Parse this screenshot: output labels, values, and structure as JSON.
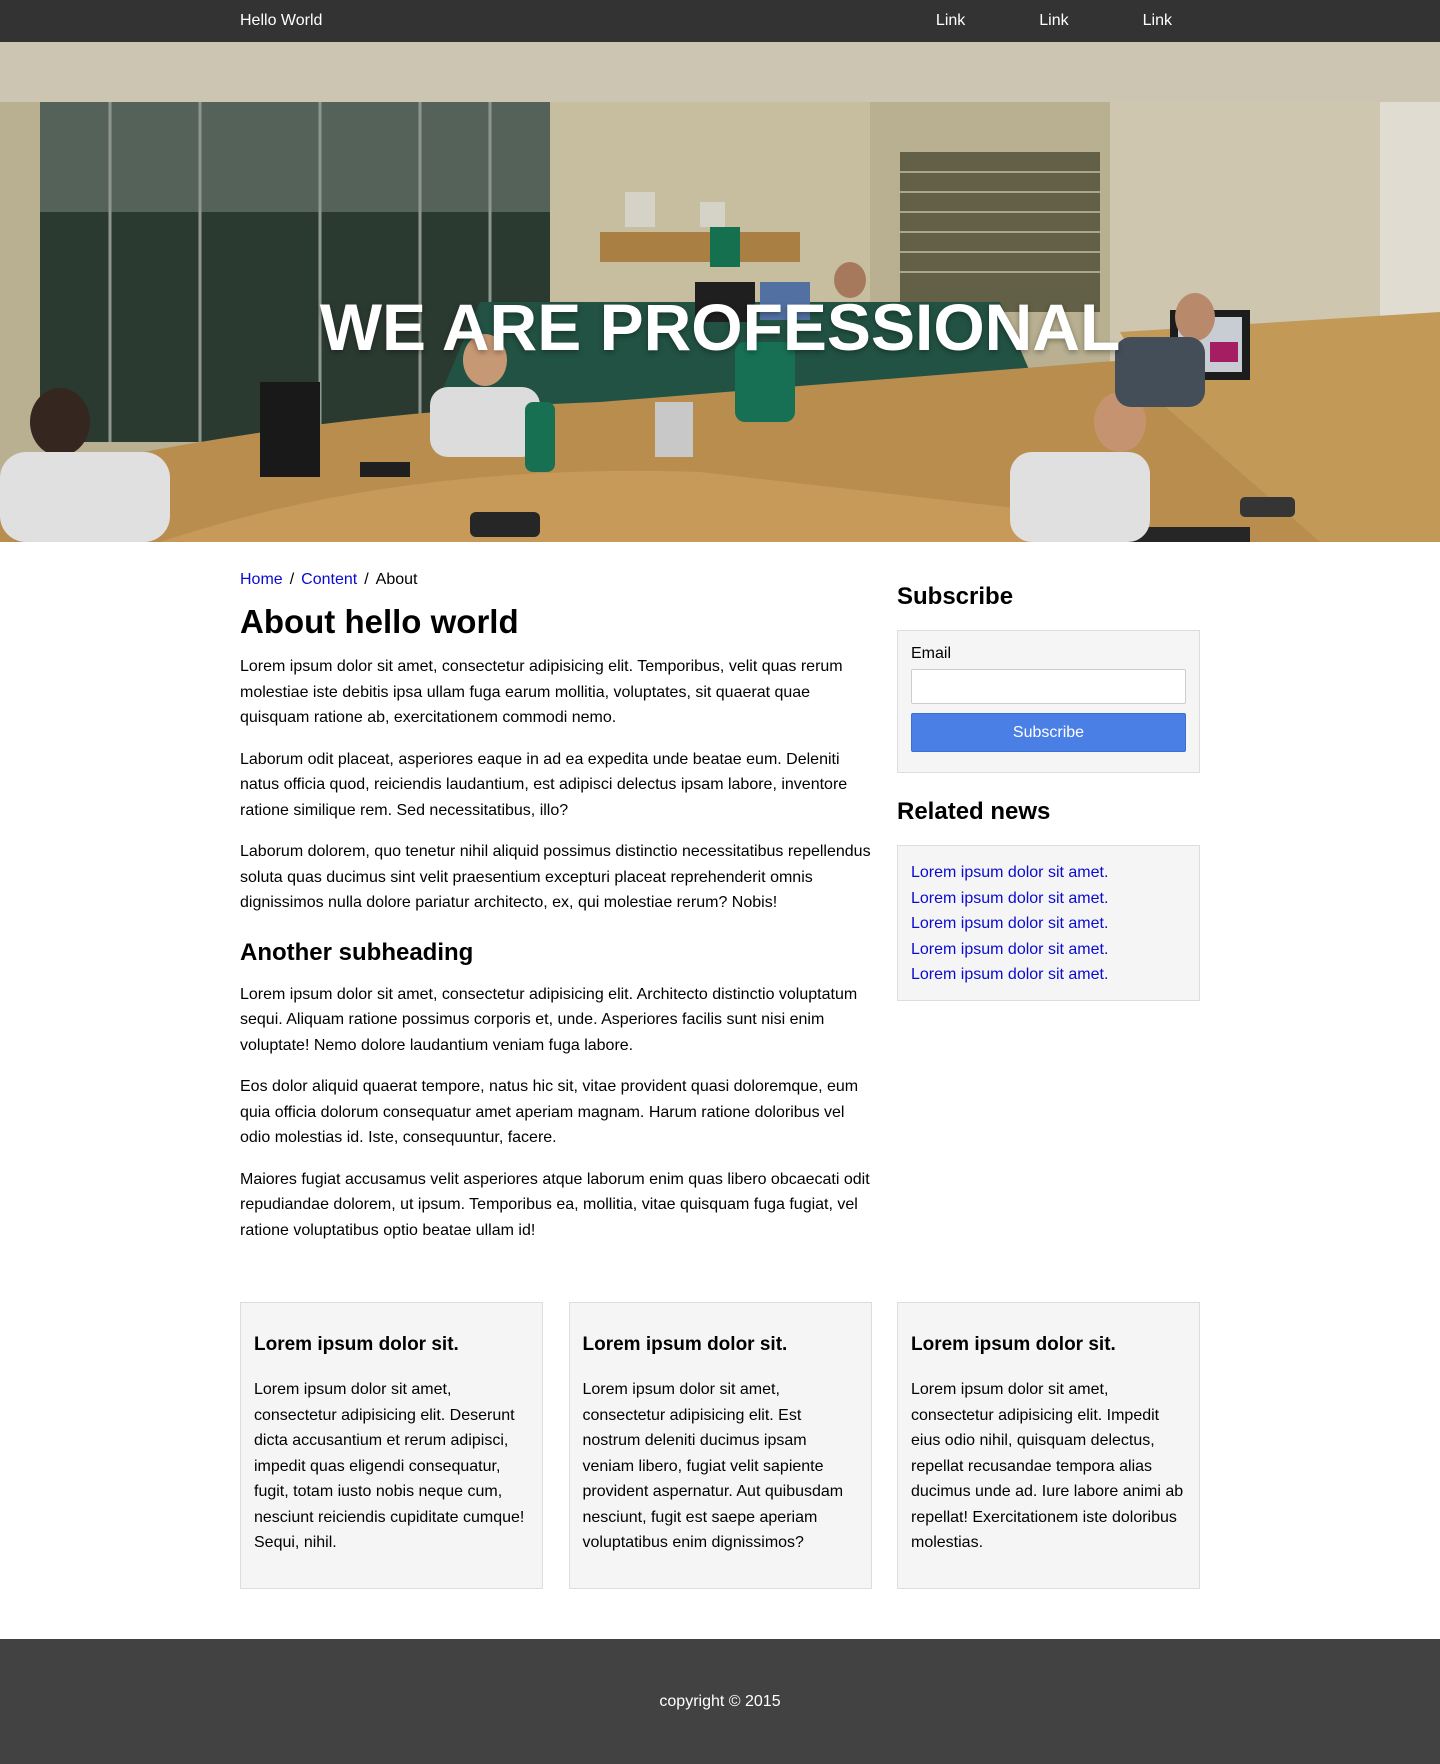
{
  "nav": {
    "brand": "Hello World",
    "links": [
      "Link",
      "Link",
      "Link"
    ]
  },
  "hero": {
    "title": "WE ARE PROFESSIONAL"
  },
  "breadcrumb": {
    "items": [
      "Home",
      "Content",
      "About"
    ],
    "separator": "/"
  },
  "main": {
    "title": "About hello world",
    "paragraphs": [
      "Lorem ipsum dolor sit amet, consectetur adipisicing elit. Temporibus, velit quas rerum molestiae iste debitis ipsa ullam fuga earum mollitia, voluptates, sit quaerat quae quisquam ratione ab, exercitationem commodi nemo.",
      "Laborum odit placeat, asperiores eaque in ad ea expedita unde beatae eum. Deleniti natus officia quod, reiciendis laudantium, est adipisci delectus ipsam labore, inventore ratione similique rem. Sed necessitatibus, illo?",
      "Laborum dolorem, quo tenetur nihil aliquid possimus distinctio necessitatibus repellendus soluta quas ducimus sint velit praesentium excepturi placeat reprehenderit omnis dignissimos nulla dolore pariatur architecto, ex, qui molestiae rerum? Nobis!"
    ],
    "subheading": "Another subheading",
    "paragraphs2": [
      "Lorem ipsum dolor sit amet, consectetur adipisicing elit. Architecto distinctio voluptatum sequi. Aliquam ratione possimus corporis et, unde. Asperiores facilis sunt nisi enim voluptate! Nemo dolore laudantium veniam fuga labore.",
      "Eos dolor aliquid quaerat tempore, natus hic sit, vitae provident quasi doloremque, eum quia officia dolorum consequatur amet aperiam magnam. Harum ratione doloribus vel odio molestias id. Iste, consequuntur, facere.",
      "Maiores fugiat accusamus velit asperiores atque laborum enim quas libero obcaecati odit repudiandae dolorem, ut ipsum. Temporibus ea, mollitia, vitae quisquam fuga fugiat, vel ratione voluptatibus optio beatae ullam id!"
    ]
  },
  "sidebar": {
    "subscribe": {
      "title": "Subscribe",
      "email_label": "Email",
      "email_value": "",
      "button_label": "Subscribe"
    },
    "related": {
      "title": "Related news",
      "items": [
        "Lorem ipsum dolor sit amet.",
        "Lorem ipsum dolor sit amet.",
        "Lorem ipsum dolor sit amet.",
        "Lorem ipsum dolor sit amet.",
        "Lorem ipsum dolor sit amet."
      ]
    }
  },
  "features": [
    {
      "title": "Lorem ipsum dolor sit.",
      "text": "Lorem ipsum dolor sit amet, consectetur adipisicing elit. Deserunt dicta accusantium et rerum adipisci, impedit quas eligendi consequatur, fugit, totam iusto nobis neque cum, nesciunt reiciendis cupiditate cumque! Sequi, nihil."
    },
    {
      "title": "Lorem ipsum dolor sit.",
      "text": "Lorem ipsum dolor sit amet, consectetur adipisicing elit. Est nostrum deleniti ducimus ipsam veniam libero, fugiat velit sapiente provident aspernatur. Aut quibusdam nesciunt, fugit est saepe aperiam voluptatibus enim dignissimos?"
    },
    {
      "title": "Lorem ipsum dolor sit.",
      "text": "Lorem ipsum dolor sit amet, consectetur adipisicing elit. Impedit eius odio nihil, quisquam delectus, repellat recusandae tempora alias ducimus unde ad. Iure labore animi ab repellat! Exercitationem iste doloribus molestias."
    }
  ],
  "footer": {
    "copyright": "copyright © 2015"
  },
  "colors": {
    "nav_bg": "#333333",
    "footer_bg": "#424242",
    "link": "#0a0ad0",
    "button": "#4a7fe6",
    "box_bg": "#f5f5f5"
  }
}
